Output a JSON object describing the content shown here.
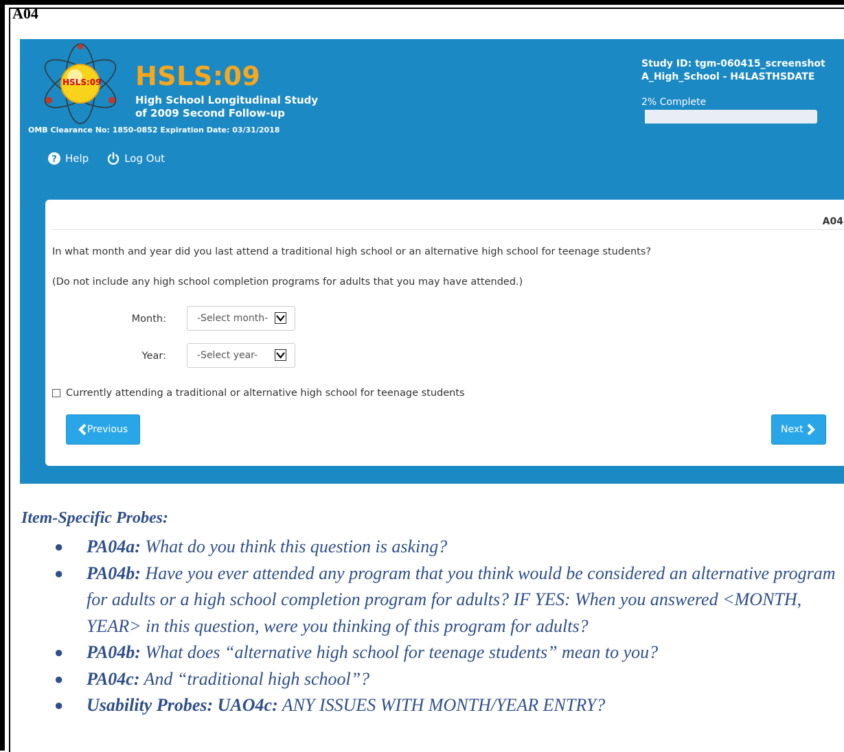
{
  "doc": {
    "label": "A04"
  },
  "header": {
    "logo_text": "HSLS:09",
    "title": "HSLS:09",
    "subtitle_line1": "High School Longitudinal Study",
    "subtitle_line2": "of 2009 Second Follow-up",
    "omb": "OMB Clearance No: 1850-0852 Expiration Date: 03/31/2018",
    "help_label": "Help",
    "logout_label": "Log Out",
    "study_id": "Study ID: tgm-060415_screenshot",
    "section": "A_High_School - H4LASTHSDATE",
    "complete_text": "2% Complete",
    "progress_percent": 2
  },
  "question": {
    "id": "A04",
    "text": "In what month and year did you last attend a traditional high school or an alternative high school for teenage students?",
    "note": "(Do not include any high school completion programs for adults that you may have attended.)",
    "month_label": "Month:",
    "month_value": "-Select month-",
    "year_label": "Year:",
    "year_value": "-Select year-",
    "checkbox_label": "Currently attending a traditional or alternative high school for teenage students",
    "previous_label": "Previous",
    "next_label": "Next"
  },
  "probes": {
    "title": "Item-Specific Probes:",
    "items": [
      {
        "code": "PA04a:",
        "text": " What do you think this question is asking?"
      },
      {
        "code": "PA04b:",
        "text": " Have you ever attended any program that you think would be considered an alternative program for adults or a high school completion program for adults?  IF YES: When you answered <MONTH, YEAR> in this question, were you thinking of this program for adults?"
      },
      {
        "code": "PA04b:",
        "text": " What does “alternative high school for teenage students” mean to you?"
      },
      {
        "code": "PA04c:",
        "text": " And “traditional high school”?"
      },
      {
        "code": "Usability Probes: UAO4c:",
        "text": "  ANY ISSUES WITH MONTH/YEAR ENTRY?"
      }
    ]
  },
  "colors": {
    "brand_blue": "#1b89c4",
    "brand_orange": "#f7a71c",
    "button_blue": "#29a6e8",
    "probe_text": "#2f4e8a"
  }
}
